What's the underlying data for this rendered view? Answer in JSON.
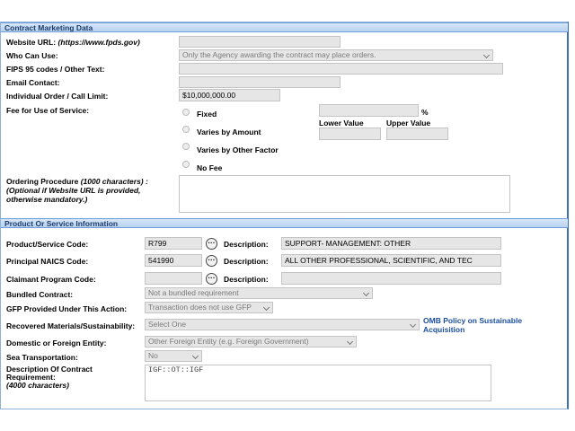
{
  "marketing": {
    "header": "Contract Marketing Data",
    "website_label": "Website URL:",
    "website_hint": "(https://www.fpds.gov)",
    "website_value": "",
    "who_label": "Who Can Use:",
    "who_value": "Only the Agency awarding the contract may place orders.",
    "fips_label": "FIPS 95 codes / Other Text:",
    "email_label": "Email Contact:",
    "limit_label": "Individual Order / Call Limit:",
    "limit_value": "$10,000,000.00",
    "fee_label": "Fee for Use of Service:",
    "fee_options": [
      "Fixed",
      "Varies by Amount",
      "Varies by Other Factor",
      "No Fee"
    ],
    "percent": "%",
    "lower_label": "Lower Value",
    "upper_label": "Upper Value",
    "ordering_label": "Ordering Procedure",
    "ordering_chars": "(1000 characters) :",
    "ordering_hint1": "(Optional if Website URL is provided,",
    "ordering_hint2": "otherwise mandatory.)"
  },
  "product": {
    "header": "Product Or Service Information",
    "psc_label": "Product/Service Code:",
    "psc_value": "R799",
    "desc_label": "Description:",
    "psc_desc": "SUPPORT- MANAGEMENT: OTHER",
    "naics_label": "Principal NAICS Code:",
    "naics_value": "541990",
    "naics_desc": "ALL OTHER PROFESSIONAL, SCIENTIFIC, AND TEC",
    "claimant_label": "Claimant Program Code:",
    "bundled_label": "Bundled Contract:",
    "bundled_value": "Not a bundled requirement",
    "gfp_label": "GFP Provided Under This Action:",
    "gfp_value": "Transaction does not use GFP",
    "recovered_label": "Recovered Materials/Sustainability:",
    "recovered_value": "Select One",
    "omb_link_line1": "OMB Policy on Sustainable",
    "omb_link_line2": "Acquisition",
    "domestic_label": "Domestic or Foreign Entity:",
    "domestic_value": "Other Foreign Entity (e.g. Foreign Government)",
    "sea_label": "Sea Transportation:",
    "sea_value": "No",
    "req_label1": "Description Of Contract",
    "req_label2": "Requirement:",
    "req_label3": "(4000 characters)",
    "req_value": "IGF::OT::IGF",
    "lookup_glyph": "···"
  }
}
